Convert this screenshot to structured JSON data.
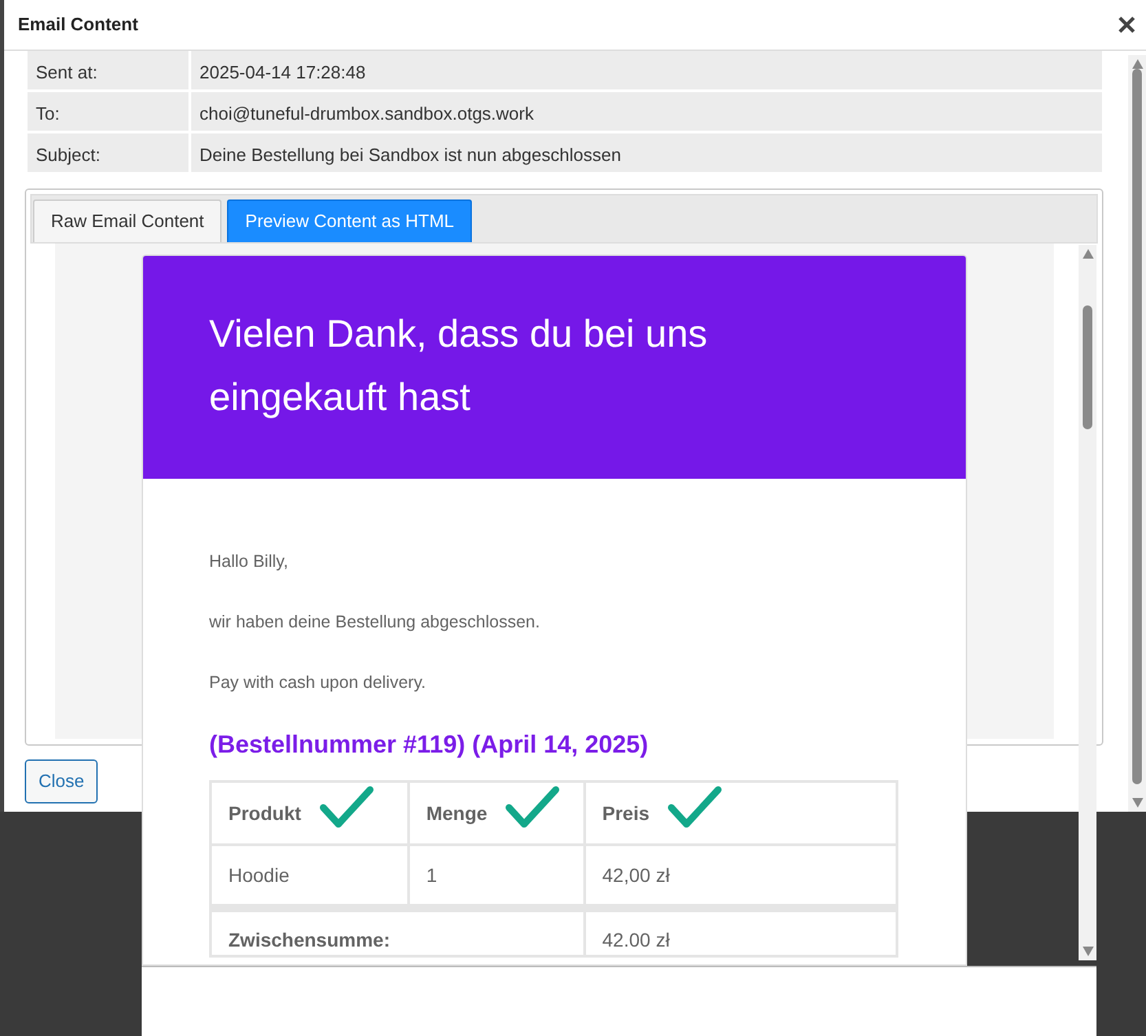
{
  "window": {
    "title": "Email Content"
  },
  "fields": [
    {
      "label": "Sent at:",
      "value": "2025-04-14 17:28:48"
    },
    {
      "label": "To:",
      "value": "choi@tuneful-drumbox.sandbox.otgs.work"
    },
    {
      "label": "Subject:",
      "value": "Deine Bestellung bei Sandbox ist nun abgeschlossen"
    }
  ],
  "tabs": [
    {
      "label": "Raw Email Content",
      "selected": false
    },
    {
      "label": "Preview Content as HTML",
      "selected": true
    }
  ],
  "email": {
    "heading": "Vielen Dank, dass du bei uns eingekauft hast",
    "paragraphs": [
      "Hallo Billy,",
      "wir haben deine Bestellung abgeschlossen.",
      "Pay with cash upon delivery."
    ],
    "order_title": "(Bestellnummer #119) (April 14, 2025)",
    "columns": [
      "Produkt",
      "Menge",
      "Preis"
    ],
    "rows": [
      [
        "Hoodie",
        "1",
        "42,00 zł"
      ]
    ],
    "totals": [
      {
        "label": "Zwischensumme:",
        "value": "42.00 zł"
      }
    ]
  },
  "buttons": [
    {
      "label": "Close"
    }
  ]
}
